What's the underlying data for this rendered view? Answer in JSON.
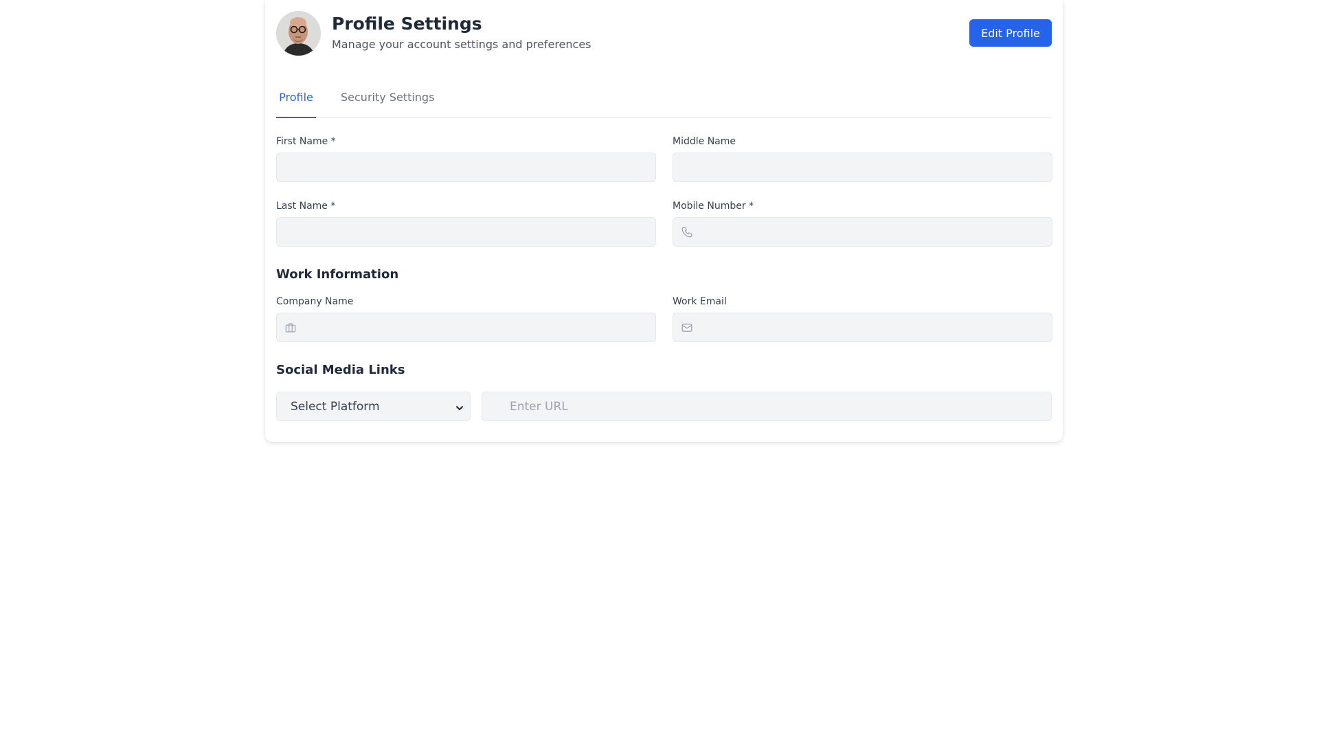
{
  "header": {
    "title": "Profile Settings",
    "subtitle": "Manage your account settings and preferences",
    "edit_button": "Edit Profile"
  },
  "tabs": [
    {
      "label": "Profile",
      "active": true
    },
    {
      "label": "Security Settings",
      "active": false
    }
  ],
  "personal": {
    "first_name": {
      "label": "First Name *",
      "value": ""
    },
    "middle_name": {
      "label": "Middle Name",
      "value": ""
    },
    "last_name": {
      "label": "Last Name *",
      "value": ""
    },
    "mobile_number": {
      "label": "Mobile Number *",
      "value": "",
      "icon": "phone-icon"
    }
  },
  "work": {
    "section_title": "Work Information",
    "company_name": {
      "label": "Company Name",
      "value": "",
      "icon": "briefcase-icon"
    },
    "work_email": {
      "label": "Work Email",
      "value": "",
      "icon": "mail-icon"
    }
  },
  "social": {
    "section_title": "Social Media Links",
    "platform_select": "Select Platform",
    "url_placeholder": "Enter URL"
  },
  "colors": {
    "accent": "#2563eb",
    "input_bg": "#f3f4f6",
    "input_border": "#e5e7eb",
    "text": "#1f2937",
    "muted": "#6b7280"
  }
}
